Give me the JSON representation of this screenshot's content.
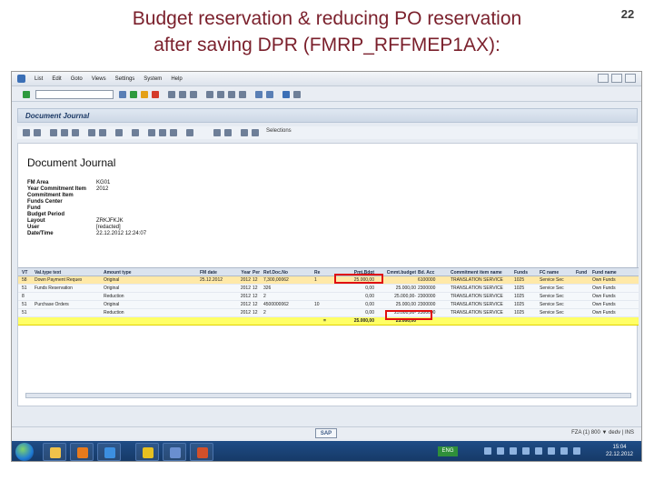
{
  "slide": {
    "title_line1": "Budget reservation & reducing PO reservation",
    "title_line2": "after saving DPR (FMRP_RFFMEP1AX):",
    "page_number": "22",
    "title_color": "#7a1f2b"
  },
  "sap": {
    "menu": [
      "List",
      "Edit",
      "Goto",
      "Views",
      "Settings",
      "System",
      "Help"
    ],
    "screen_title": "Document Journal",
    "toolbar_label": "Selections",
    "report_heading": "Document Journal",
    "meta": [
      {
        "key": "FM Area",
        "value": "KG01"
      },
      {
        "key": "Year Commitment Item",
        "value": "2012"
      },
      {
        "key": "Commitment Item",
        "value": ""
      },
      {
        "key": "Funds Center",
        "value": ""
      },
      {
        "key": "Fund",
        "value": ""
      },
      {
        "key": "Budget Period",
        "value": ""
      },
      {
        "key": "Layout",
        "value": "ZRKJFKJK"
      },
      {
        "key": "User",
        "value": "[redacted]"
      },
      {
        "key": "Date/Time",
        "value": "22.12.2012 12:24:07"
      }
    ],
    "columns": [
      "VT",
      "Val.type text",
      "Amount type",
      "FM date",
      "Year",
      "Per",
      "Ref.Doc.No",
      "Re",
      "Pmt.Bdgt",
      "Cmmt.budget",
      "Bd. Acc",
      "Commitment item name",
      "Funds",
      "FC name",
      "Fund",
      "Fund name"
    ],
    "rows": [
      [
        "58",
        "Down Payment Request",
        "Original",
        "25.12.2012",
        "2012",
        "12",
        "7,300,00062",
        "1",
        "25.000,00",
        "",
        "6100000",
        "TRANSLATION SERVICE",
        "1025",
        "Service Sec",
        "",
        "Own Funds"
      ],
      [
        "51",
        "Funds Reservation",
        "Original",
        "",
        "2012",
        "12",
        "326",
        "",
        "0,00",
        "25.000,00",
        "2300000",
        "TRANSLATION SERVICE",
        "1025",
        "Service Sec",
        "",
        "Own Funds"
      ],
      [
        "8",
        "",
        "Reduction",
        "",
        "2012",
        "12",
        "2",
        "",
        "0,00",
        "25.000,00-",
        "2300000",
        "TRANSLATION SERVICE",
        "1025",
        "Service Sec",
        "",
        "Own Funds"
      ],
      [
        "51",
        "Purchase Orders",
        "Original",
        "",
        "2012",
        "12",
        "4500000062",
        "10",
        "0,00",
        "25.000,00",
        "2300000",
        "TRANSLATION SERVICE",
        "1025",
        "Service Sec",
        "",
        "Own Funds"
      ],
      [
        "51",
        "",
        "Reduction",
        "",
        "2012",
        "12",
        "2",
        "",
        "0,00",
        "25.000,00-",
        "2300000",
        "TRANSLATION SERVICE",
        "1025",
        "Service Sec",
        "",
        "Own Funds"
      ]
    ],
    "totals": {
      "marker": "=",
      "pmt_total": "25.000,00",
      "cmmt_total": "25.000,00"
    },
    "sap_logo": "SAP",
    "status_right": "FZA (1) 800 ▼  dedv | INS"
  },
  "taskbar": {
    "language": "ENG",
    "clock_time": "15:04",
    "clock_date": "22.12.2012"
  }
}
